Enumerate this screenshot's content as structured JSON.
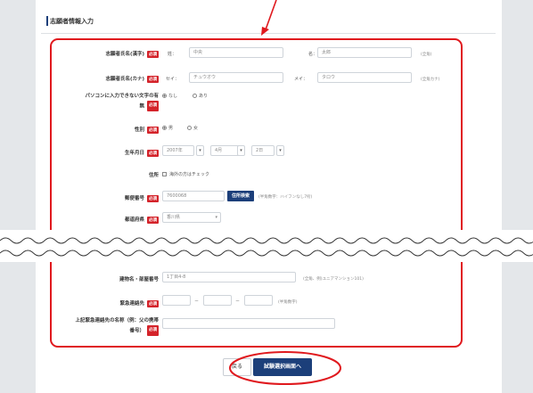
{
  "section_title": "志願者情報入力",
  "required_badge": "必須",
  "name_kanji": {
    "label": "志願者氏名(漢字)",
    "sei_label": "姓：",
    "sei_value": "中央",
    "mei_label": "名：",
    "mei_value": "太郎",
    "note": "(全角)"
  },
  "name_kana": {
    "label": "志願者氏名(カナ)",
    "sei_label": "セイ：",
    "sei_value": "チュウオウ",
    "mei_label": "メイ：",
    "mei_value": "タロウ",
    "note": "(全角カナ)"
  },
  "pc_chars": {
    "label_line1": "パソコンに入力できない文字の有",
    "label_line2": "無",
    "options": [
      "なし",
      "あり"
    ],
    "selected": "なし"
  },
  "gender": {
    "label": "性別",
    "options": [
      "男",
      "女"
    ],
    "selected": "男"
  },
  "birth": {
    "label": "生年月日",
    "year": "2007年",
    "month": "4月",
    "day": "2日"
  },
  "address": {
    "label": "住所",
    "overseas_check": "海外の方はチェック"
  },
  "postal": {
    "label": "郵便番号",
    "value": "7600068",
    "search_button": "住所検索",
    "note": "(半角数字：ハイフンなし7桁)"
  },
  "prefecture": {
    "label": "都道府県",
    "value": "香川県"
  },
  "building": {
    "label": "建物名・部屋番号",
    "value": "1丁目4-8",
    "note": "(全角、例)ユニアマンション101)"
  },
  "emergency": {
    "label": "緊急連絡先",
    "dash": "－",
    "note": "(半角数字)"
  },
  "emergency_name": {
    "label_line1": "上記緊急連絡先の名称（例：父の携帯",
    "label_line2": "番号）"
  },
  "buttons": {
    "back": "戻る",
    "submit": "試験選択画面へ"
  },
  "colors": {
    "accent_red": "#e0191e",
    "navy": "#1c3f7a",
    "required_badge": "#d4232a"
  }
}
